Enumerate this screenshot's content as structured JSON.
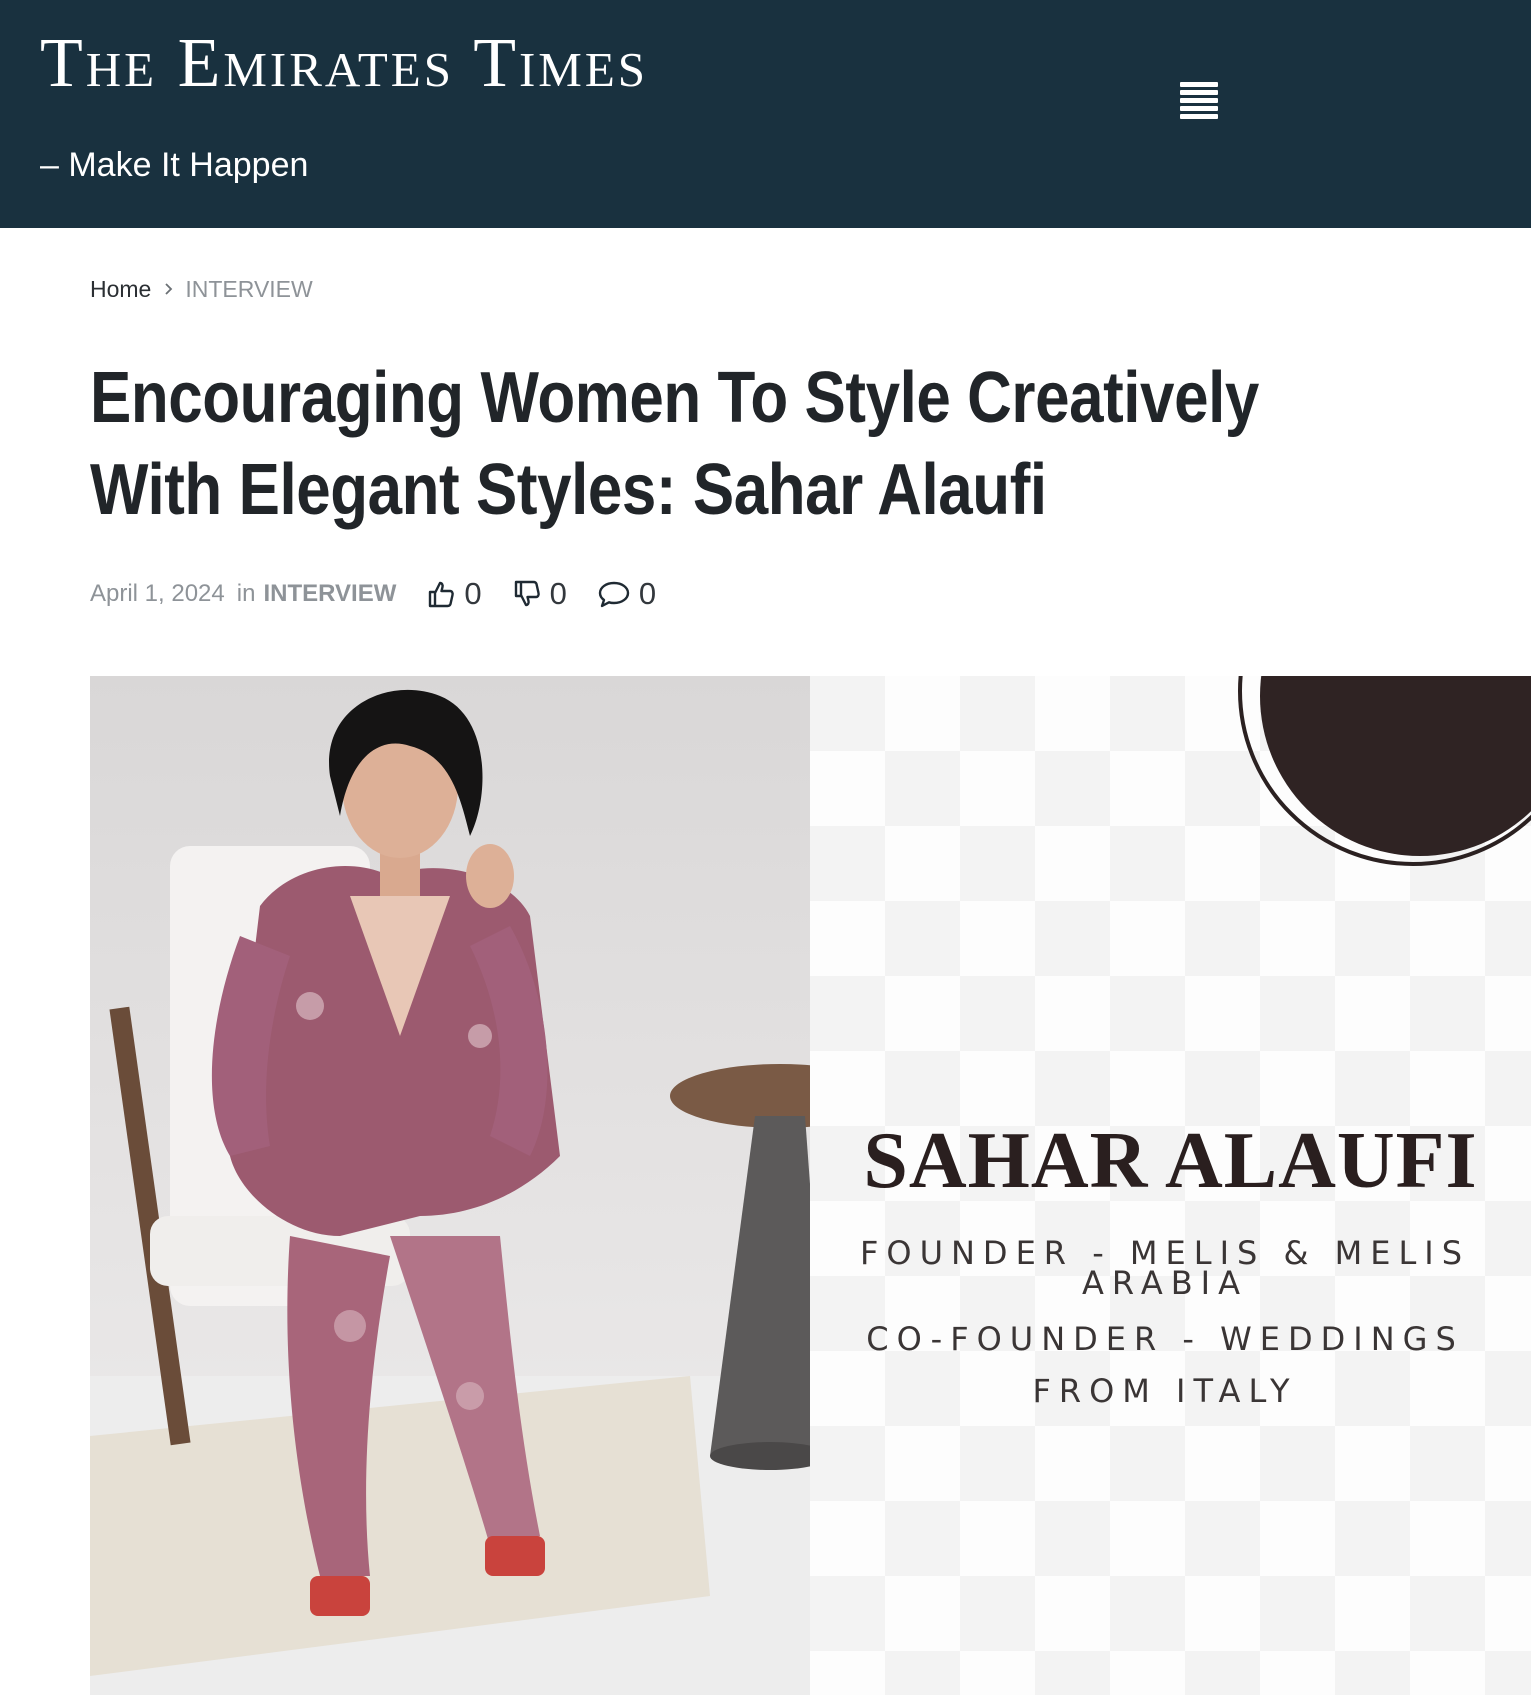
{
  "header": {
    "site_title": "The Emirates Times",
    "tagline": "– Make It Happen",
    "menu_icon": "hamburger-menu-icon",
    "background_color": "#19313f"
  },
  "breadcrumb": {
    "home": "Home",
    "current": "INTERVIEW"
  },
  "article": {
    "title_line1": "Encouraging Women To Style Creatively",
    "title_line2": "With Elegant Styles: Sahar Alaufi",
    "date": "April 1, 2024",
    "in_label": "in",
    "category": "INTERVIEW",
    "likes": "0",
    "dislikes": "0",
    "comments": "0"
  },
  "hero": {
    "name": "SAHAR ALAUFI",
    "role_line1": "FOUNDER - MELIS & MELIS",
    "role_line2": "ARABIA",
    "role_line3": "CO-FOUNDER - WEDDINGS",
    "role_line4": "FROM ITALY"
  }
}
